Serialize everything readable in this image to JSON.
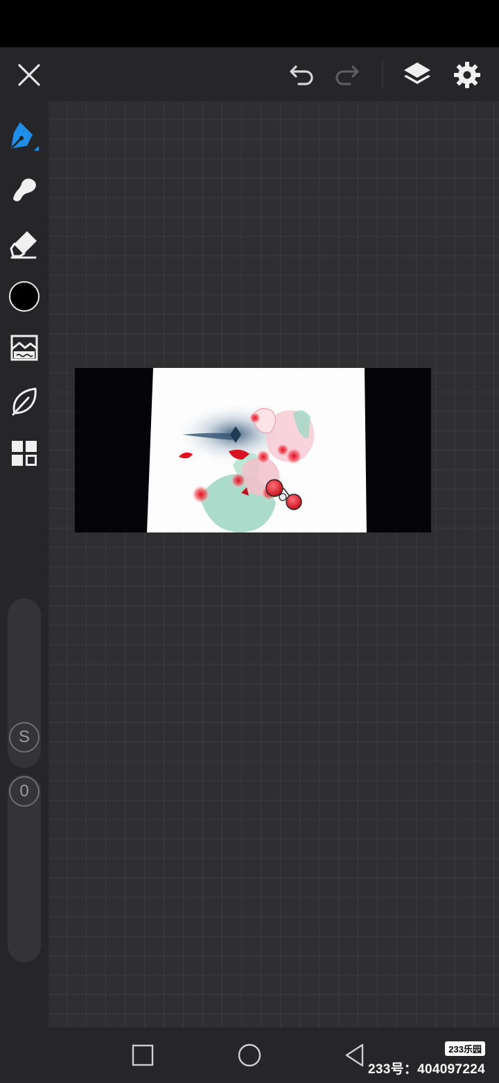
{
  "toolbar": {
    "close_icon": "close-icon",
    "undo_icon": "undo-icon",
    "redo_icon": "redo-icon",
    "layers_icon": "layers-icon",
    "settings_icon": "gear-icon"
  },
  "tools": [
    {
      "name": "pen",
      "icon": "pen-icon",
      "active": true
    },
    {
      "name": "smudge",
      "icon": "smudge-icon"
    },
    {
      "name": "eraser",
      "icon": "eraser-icon"
    },
    {
      "name": "color",
      "icon": "color-swatch",
      "value": "#000000"
    },
    {
      "name": "image",
      "icon": "image-icon"
    },
    {
      "name": "leaf",
      "icon": "leaf-icon"
    },
    {
      "name": "more",
      "icon": "grid-icon"
    }
  ],
  "size_slider": {
    "label": "S"
  },
  "opacity_slider": {
    "label": "0"
  },
  "watermark": {
    "logo": "233乐园",
    "id_text": "233号：404097224"
  },
  "colors": {
    "accent": "#1e8fe8",
    "toolbar_bg": "#262629",
    "canvas_bg": "#2f2e31"
  }
}
